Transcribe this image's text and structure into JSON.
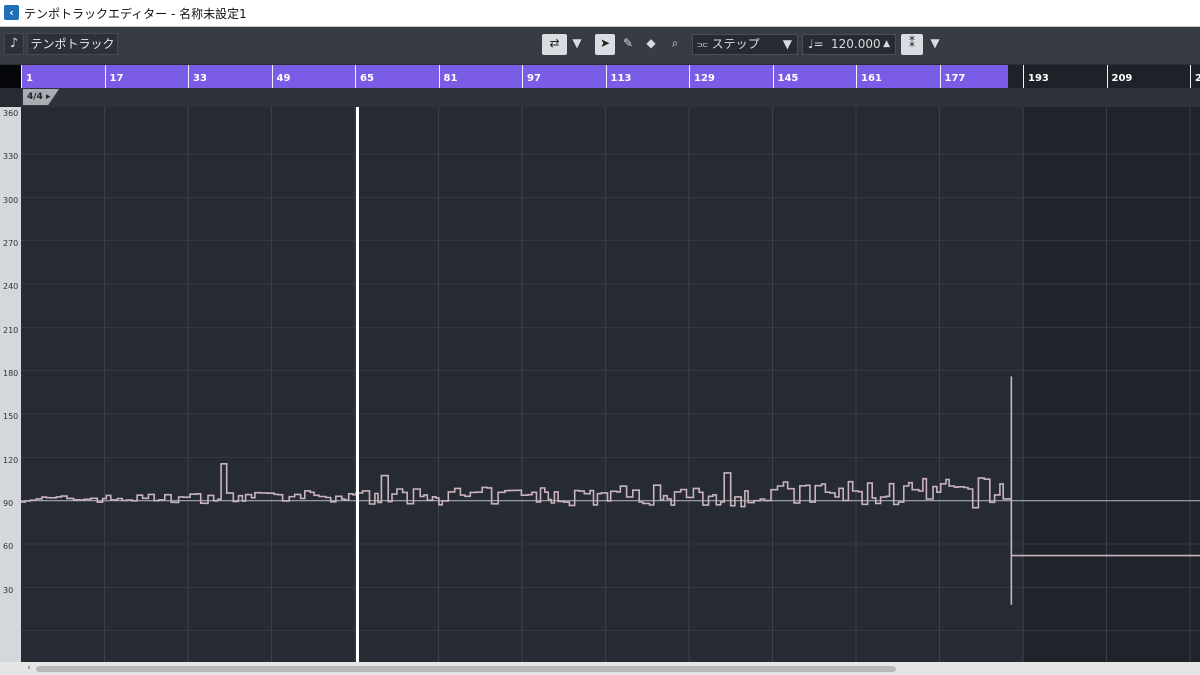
{
  "window": {
    "title": "テンポトラックエディター - 名称未設定1"
  },
  "toolbar": {
    "track_label": "テンポトラック",
    "mode_label": "ステップ",
    "tempo_value": "120.000"
  },
  "ruler": {
    "ticks": [
      "1",
      "17",
      "33",
      "49",
      "65",
      "81",
      "97",
      "113",
      "129",
      "145",
      "161",
      "177",
      "193",
      "209",
      "2"
    ]
  },
  "signature": "4/4",
  "y_axis": {
    "labels": [
      "360",
      "330",
      "300",
      "270",
      "240",
      "210",
      "180",
      "150",
      "120",
      "90",
      "60",
      "30"
    ]
  },
  "colors": {
    "ruler_active": "#7b5ce6",
    "grid_background": "#252a33",
    "tempo_line": "#c9b3bd",
    "base_line": "#a6a9ae"
  },
  "tempo_data": {
    "y_range": [
      0,
      360
    ],
    "bar_range": [
      1,
      193
    ],
    "end_bar": 190,
    "spike": {
      "top": 206,
      "bottom": 48
    },
    "after_tempo": 82
  }
}
